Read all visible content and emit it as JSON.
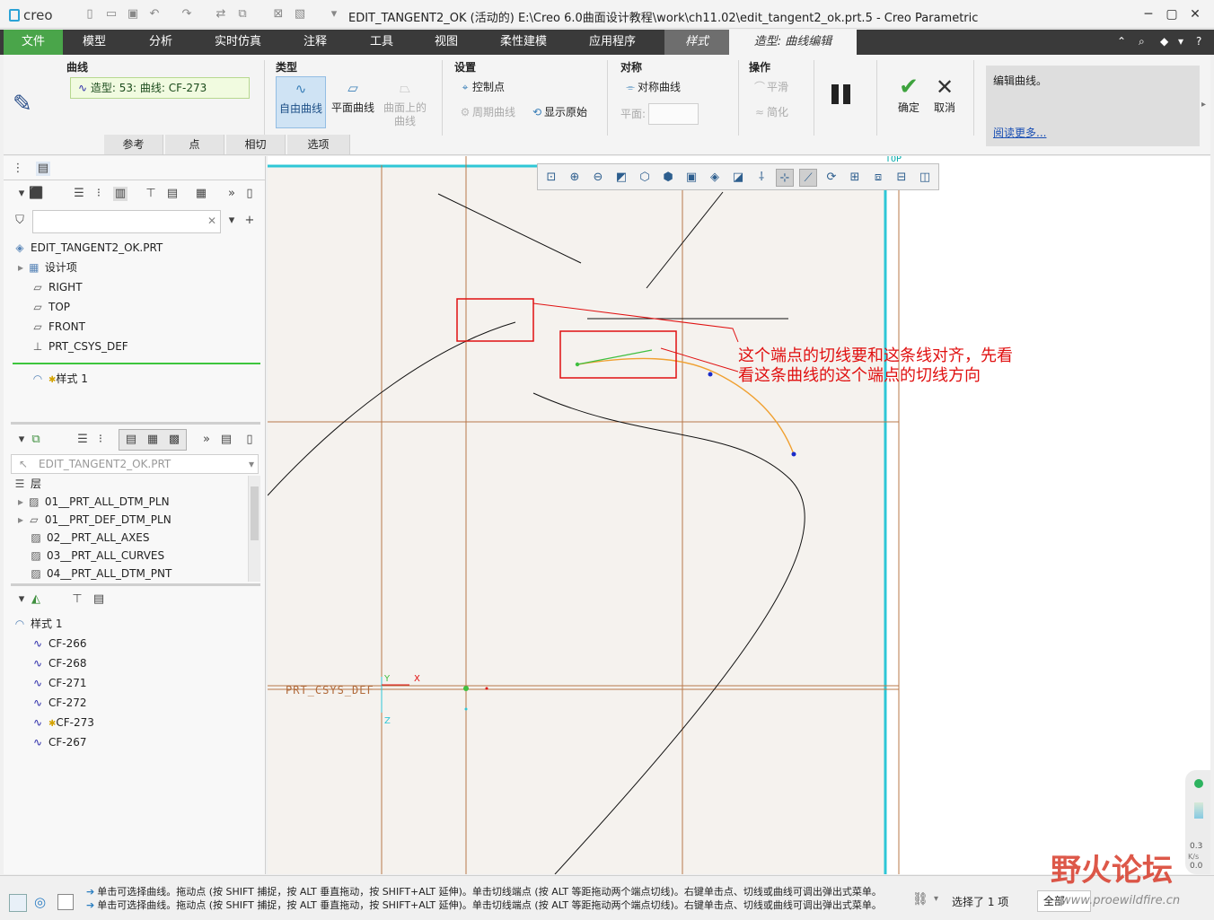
{
  "app": {
    "logo": "creo",
    "title": "EDIT_TANGENT2_OK (活动的) E:\\Creo 6.0曲面设计教程\\work\\ch11.02\\edit_tangent2_ok.prt.5 - Creo Parametric"
  },
  "tabs": [
    "文件",
    "模型",
    "分析",
    "实时仿真",
    "注释",
    "工具",
    "视图",
    "柔性建模",
    "应用程序",
    "样式",
    "造型: 曲线编辑"
  ],
  "ribbon": {
    "curve_group": "曲线",
    "curve_value": "造型: 53: 曲线: CF-273",
    "type_group": "类型",
    "type_free": "自由曲线",
    "type_plane": "平面曲线",
    "type_surface": "曲面上的曲线",
    "settings_group": "设置",
    "control_points": "控制点",
    "periodic_curve": "周期曲线",
    "show_original": "显示原始",
    "symmetry_group": "对称",
    "symmetric_curve": "对称曲线",
    "plane_label": "平面:",
    "operation_group": "操作",
    "smooth": "平滑",
    "simplify": "简化",
    "ok": "确定",
    "cancel": "取消",
    "help_text": "编辑曲线。",
    "help_link": "阅读更多...",
    "bottom_tabs": [
      "参考",
      "点",
      "相切",
      "选项"
    ]
  },
  "model_tree": {
    "root": "EDIT_TANGENT2_OK.PRT",
    "items": [
      "设计项",
      "RIGHT",
      "TOP",
      "FRONT",
      "PRT_CSYS_DEF"
    ],
    "style_item": "样式 1"
  },
  "layers": {
    "select_value": "EDIT_TANGENT2_OK.PRT",
    "header": "层",
    "items": [
      "01__PRT_ALL_DTM_PLN",
      "01__PRT_DEF_DTM_PLN",
      "02__PRT_ALL_AXES",
      "03__PRT_ALL_CURVES",
      "04__PRT_ALL_DTM_PNT"
    ]
  },
  "style_tree": {
    "root": "样式 1",
    "items": [
      "CF-266",
      "CF-268",
      "CF-271",
      "CF-272",
      "CF-273",
      "CF-267"
    ]
  },
  "graphics": {
    "annotation_line1": "这个端点的切线要和这条线对齐，先看",
    "annotation_line2": "看这条曲线的这个端点的切线方向",
    "csys_label": "PRT_CSYS_DEF",
    "top_label": "TOP",
    "axis_x": "X",
    "axis_y": "Y",
    "axis_z": "Z",
    "zoom_top": "0.3",
    "zoom_unit": "K/s",
    "zoom_bottom": "0.0"
  },
  "status": {
    "message1": "单击可选择曲线。拖动点 (按 SHIFT 捕捉，按 ALT 垂直拖动，按 SHIFT+ALT 延伸)。单击切线端点 (按 ALT 等距拖动两个端点切线)。右键单击点、切线或曲线可调出弹出式菜单。",
    "message2": "单击可选择曲线。拖动点 (按 SHIFT 捕捉，按 ALT 垂直拖动，按 SHIFT+ALT 延伸)。单击切线端点 (按 ALT 等距拖动两个端点切线)。右键单击点、切线或曲线可调出弹出式菜单。",
    "selected": "选择了 1 项",
    "filter": "全部"
  },
  "watermark": {
    "text": "野火论坛",
    "url": "www.proewildfire.cn"
  },
  "colors": {
    "accent_green": "#4aa54a",
    "annotation_red": "#e01010",
    "datum_cyan": "#2fc7d6",
    "curve_orange": "#f0a030"
  }
}
